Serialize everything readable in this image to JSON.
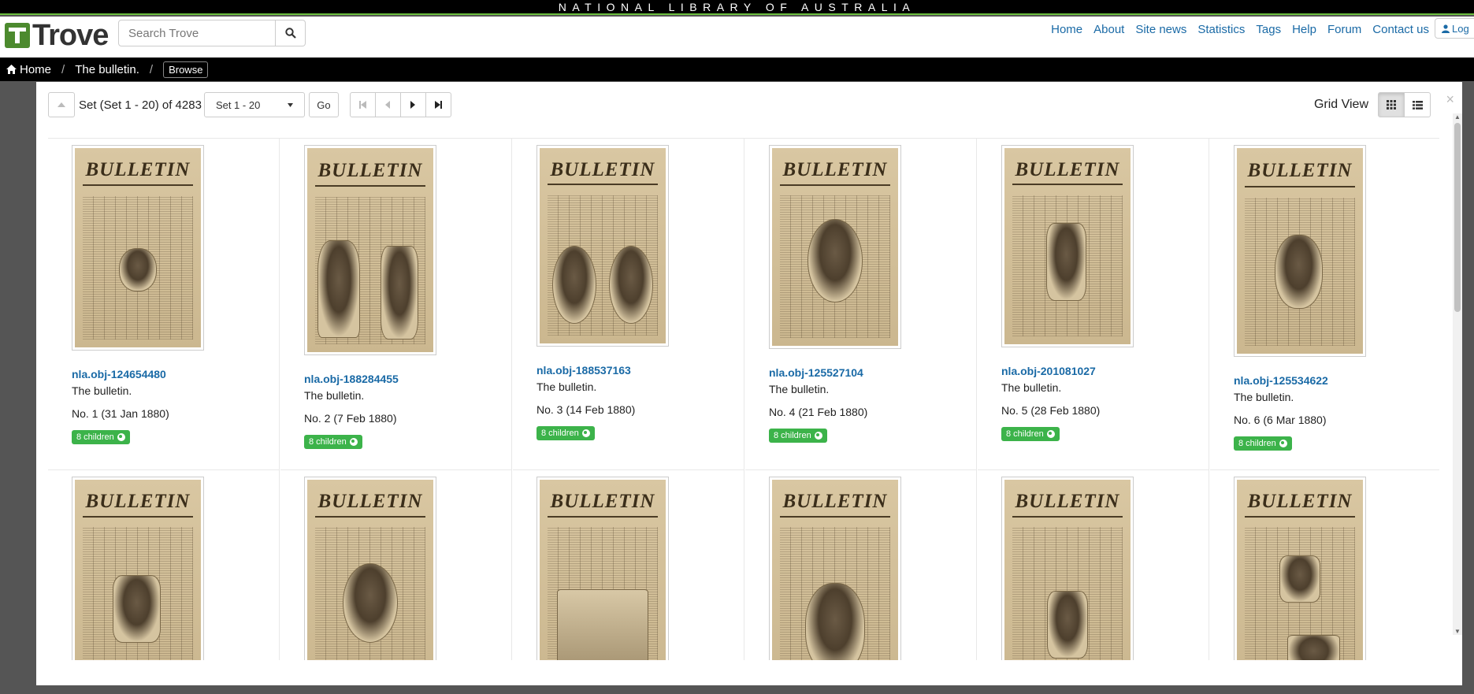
{
  "banner": "NATIONAL LIBRARY OF AUSTRALIA",
  "header": {
    "logo_text": "Trove",
    "search_placeholder": "Search Trove",
    "nav": [
      "Home",
      "About",
      "Site news",
      "Statistics",
      "Tags",
      "Help",
      "Forum",
      "Contact us"
    ],
    "login_label": "Log"
  },
  "breadcrumb": {
    "home": "Home",
    "item": "The bulletin.",
    "current": "Browse"
  },
  "toolbar": {
    "set_text": "Set (Set 1 - 20) of 4283",
    "set_select": "Set 1 - 20",
    "go_label": "Go",
    "view_label": "Grid View"
  },
  "items": [
    {
      "id": "nla.obj-124654480",
      "title": "The bulletin.",
      "no": "No. 1 (31 Jan 1880)",
      "children": "8 children"
    },
    {
      "id": "nla.obj-188284455",
      "title": "The bulletin.",
      "no": "No. 2 (7 Feb 1880)",
      "children": "8 children"
    },
    {
      "id": "nla.obj-188537163",
      "title": "The bulletin.",
      "no": "No. 3 (14 Feb 1880)",
      "children": "8 children"
    },
    {
      "id": "nla.obj-125527104",
      "title": "The bulletin.",
      "no": "No. 4 (21 Feb 1880)",
      "children": "8 children"
    },
    {
      "id": "nla.obj-201081027",
      "title": "The bulletin.",
      "no": "No. 5 (28 Feb 1880)",
      "children": "8 children"
    },
    {
      "id": "nla.obj-125534622",
      "title": "The bulletin.",
      "no": "No. 6 (6 Mar 1880)",
      "children": "8 children"
    }
  ],
  "masthead_text": "BULLETIN"
}
